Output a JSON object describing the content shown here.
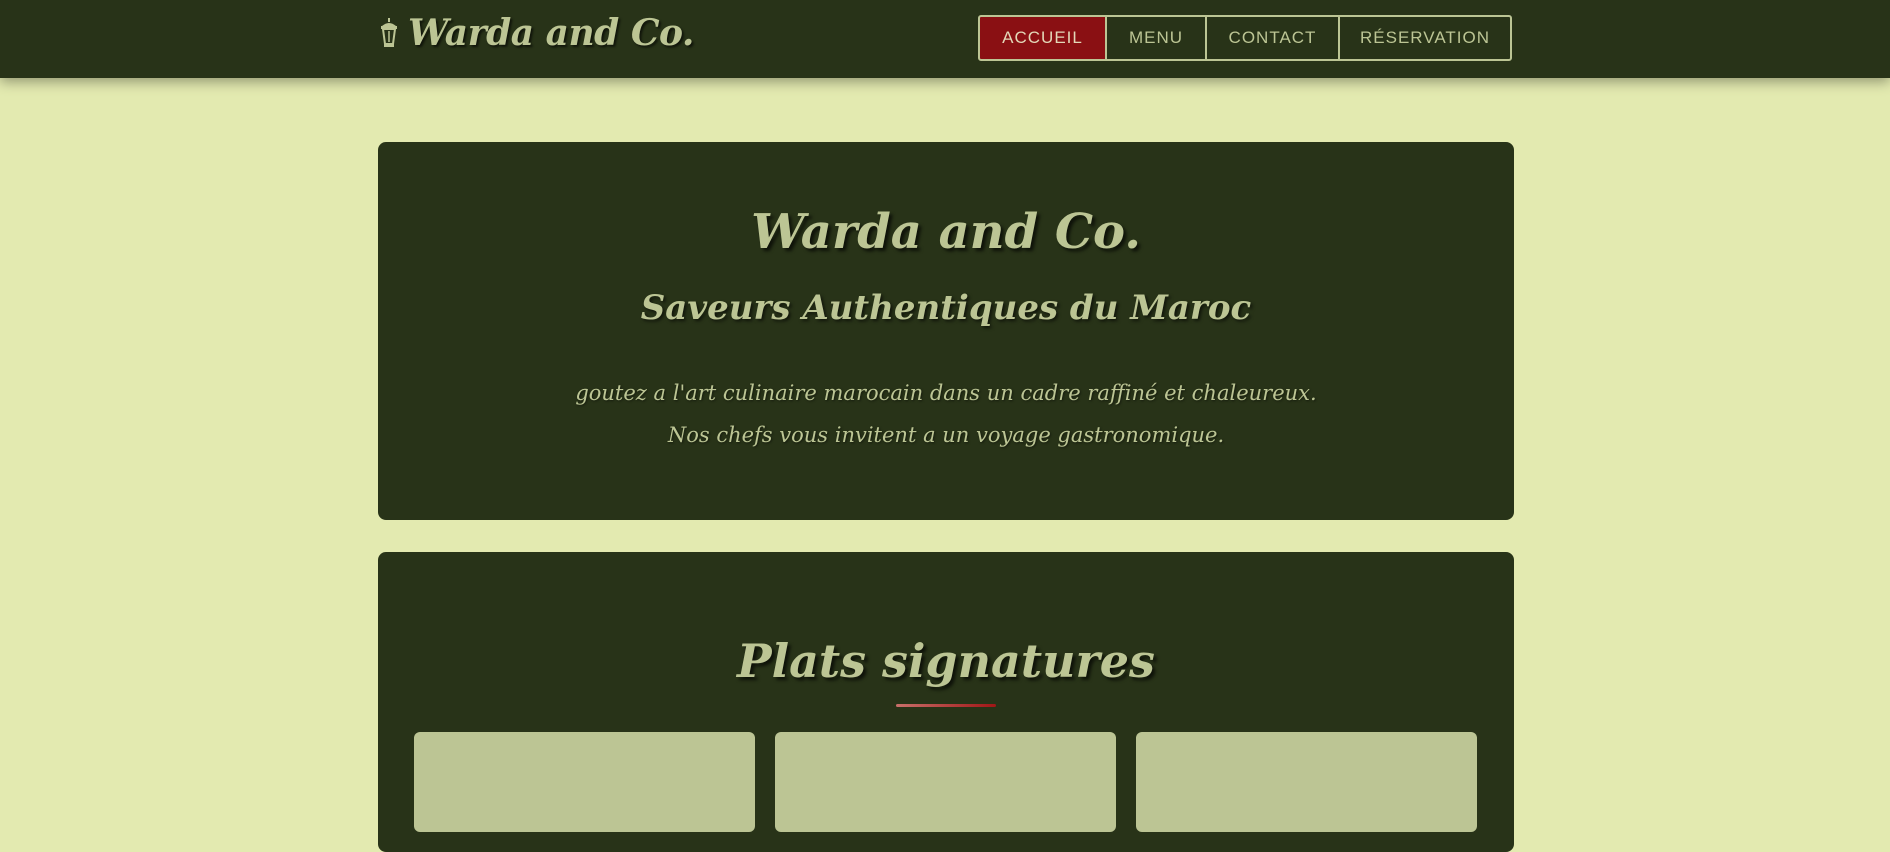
{
  "header": {
    "brand": "Warda and Co.",
    "brand_icon": "lantern-icon",
    "nav": [
      {
        "label": "ACCUEIL",
        "active": true
      },
      {
        "label": "MENU",
        "active": false
      },
      {
        "label": "CONTACT",
        "active": false
      },
      {
        "label": "RÉSERVATION",
        "active": false
      }
    ]
  },
  "hero": {
    "title": "Warda and Co.",
    "subtitle": "Saveurs Authentiques du Maroc",
    "lines": [
      "goutez a l'art culinaire marocain dans un cadre raffiné et chaleureux.",
      "Nos chefs vous invitent a un voyage gastronomique."
    ]
  },
  "signature": {
    "title": "Plats signatures"
  },
  "colors": {
    "page_background": "#e3eab0",
    "dark_green": "#283318",
    "sage_text": "#bcc594",
    "active_red": "#8a1013"
  }
}
